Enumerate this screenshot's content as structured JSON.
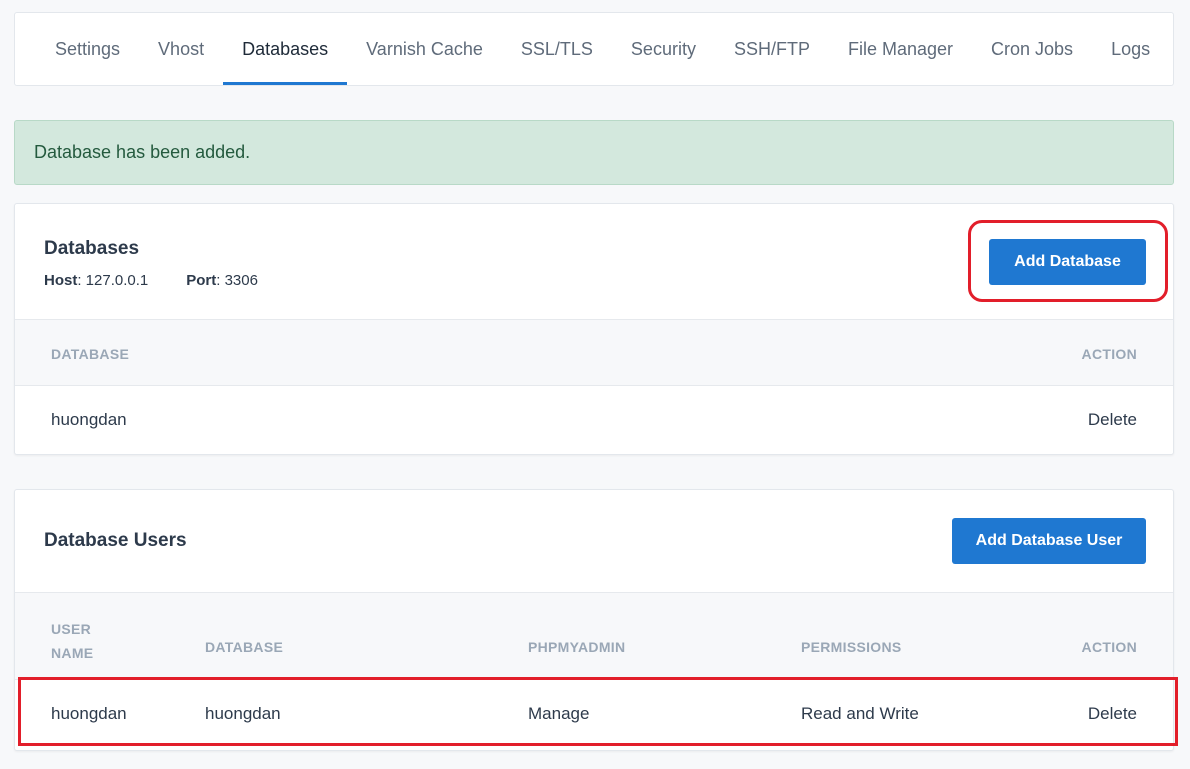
{
  "tabs": [
    {
      "label": "Settings",
      "active": false
    },
    {
      "label": "Vhost",
      "active": false
    },
    {
      "label": "Databases",
      "active": true
    },
    {
      "label": "Varnish Cache",
      "active": false
    },
    {
      "label": "SSL/TLS",
      "active": false
    },
    {
      "label": "Security",
      "active": false
    },
    {
      "label": "SSH/FTP",
      "active": false
    },
    {
      "label": "File Manager",
      "active": false
    },
    {
      "label": "Cron Jobs",
      "active": false
    },
    {
      "label": "Logs",
      "active": false
    }
  ],
  "alert": {
    "message": "Database has been added."
  },
  "databases": {
    "title": "Databases",
    "host_label": "Host",
    "host_value": ": 127.0.0.1",
    "port_label": "Port",
    "port_value": ": 3306",
    "add_button": "Add Database",
    "columns": {
      "database": "DATABASE",
      "action": "ACTION"
    },
    "rows": [
      {
        "database": "huongdan",
        "action": "Delete"
      }
    ]
  },
  "users": {
    "title": "Database Users",
    "add_button": "Add Database User",
    "columns": {
      "user_name_line1": "USER",
      "user_name_line2": "NAME",
      "database": "DATABASE",
      "phpmyadmin": "PHPMYADMIN",
      "permissions": "PERMISSIONS",
      "action": "ACTION"
    },
    "rows": [
      {
        "user_name": "huongdan",
        "database": "huongdan",
        "phpmyadmin": "Manage",
        "permissions": "Read and Write",
        "action": "Delete"
      }
    ]
  },
  "colors": {
    "accent": "#1f78d1",
    "highlight": "#e21e2a",
    "alert_bg": "#d3e8dd"
  }
}
